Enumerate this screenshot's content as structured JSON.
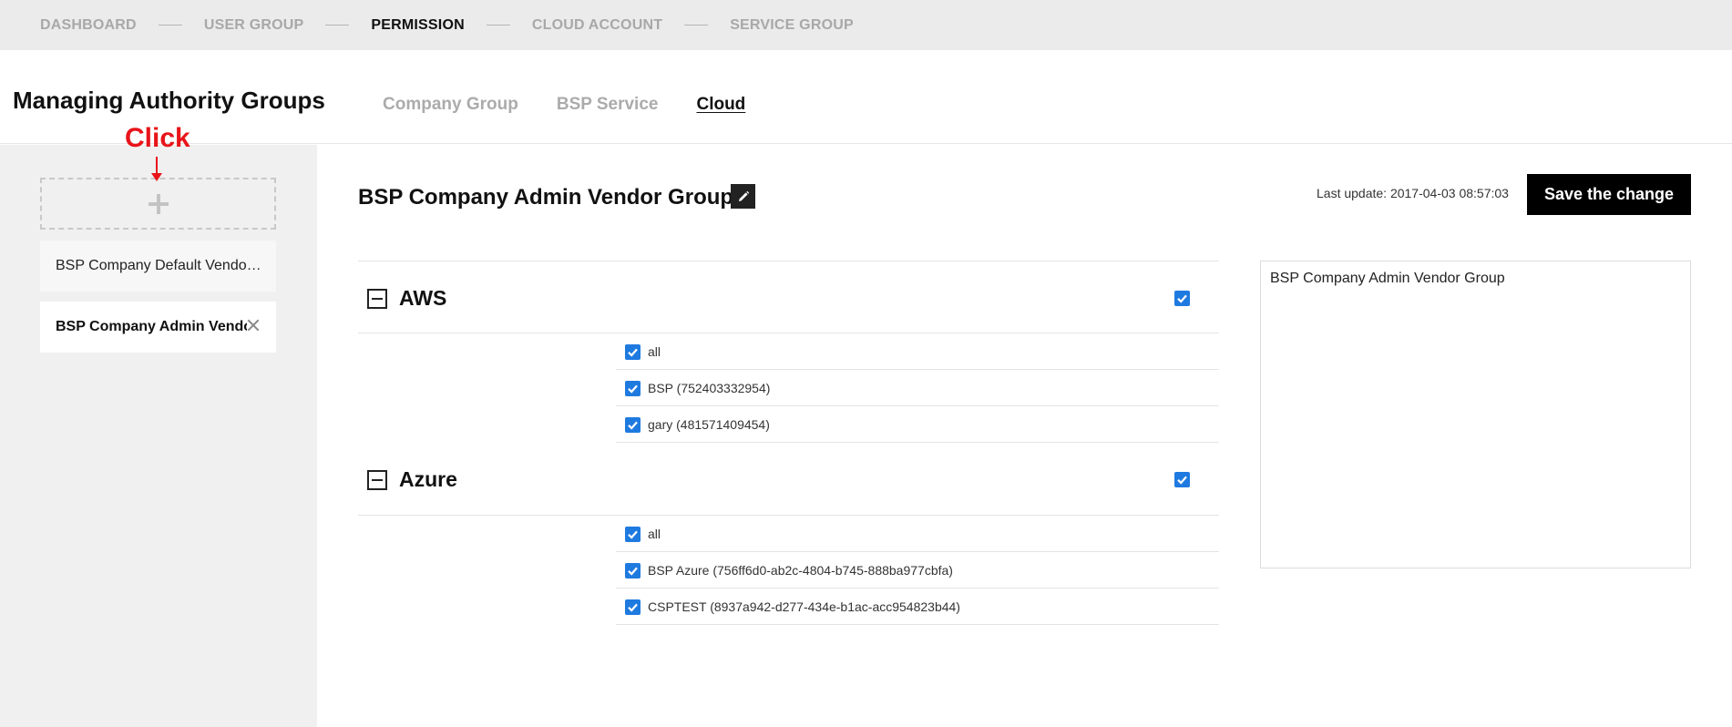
{
  "topnav": {
    "steps": [
      {
        "label": "DASHBOARD",
        "active": false
      },
      {
        "label": "USER GROUP",
        "active": false
      },
      {
        "label": "PERMISSION",
        "active": true
      },
      {
        "label": "CLOUD ACCOUNT",
        "active": false
      },
      {
        "label": "SERVICE GROUP",
        "active": false
      }
    ]
  },
  "header": {
    "title": "Managing Authority Groups",
    "tabs": [
      {
        "label": "Company Group",
        "active": false
      },
      {
        "label": "BSP Service",
        "active": false
      },
      {
        "label": "Cloud",
        "active": true
      }
    ]
  },
  "annotation": {
    "click_note": "Click",
    "color": "#e8141a"
  },
  "sidebar": {
    "add_icon": "plus-icon",
    "groups": [
      {
        "label": "BSP Company Default Vendor Group",
        "selected": false
      },
      {
        "label": "BSP Company Admin Vendor Group",
        "selected": true
      }
    ]
  },
  "main": {
    "group_title": "BSP Company Admin Vendor Group",
    "edit_icon": "pencil-icon",
    "last_update": "Last update: 2017-04-03 08:57:03",
    "save_label": "Save the change",
    "description": "BSP Company Admin Vendor Group",
    "sections": [
      {
        "name": "AWS",
        "checked": true,
        "items": [
          {
            "label": "all",
            "checked": true
          },
          {
            "label": "BSP (752403332954)",
            "checked": true
          },
          {
            "label": "gary (481571409454)",
            "checked": true
          }
        ]
      },
      {
        "name": "Azure",
        "checked": true,
        "items": [
          {
            "label": "all",
            "checked": true
          },
          {
            "label": "BSP Azure (756ff6d0-ab2c-4804-b745-888ba977cbfa)",
            "checked": true
          },
          {
            "label": "CSPTEST (8937a942-d277-434e-b1ac-acc954823b44)",
            "checked": true
          }
        ]
      }
    ]
  },
  "colors": {
    "checkbox": "#1f7ae0",
    "nav_bg": "#ebebeb",
    "sidebar_bg": "#f0f0f0",
    "save_bg": "#000000"
  }
}
